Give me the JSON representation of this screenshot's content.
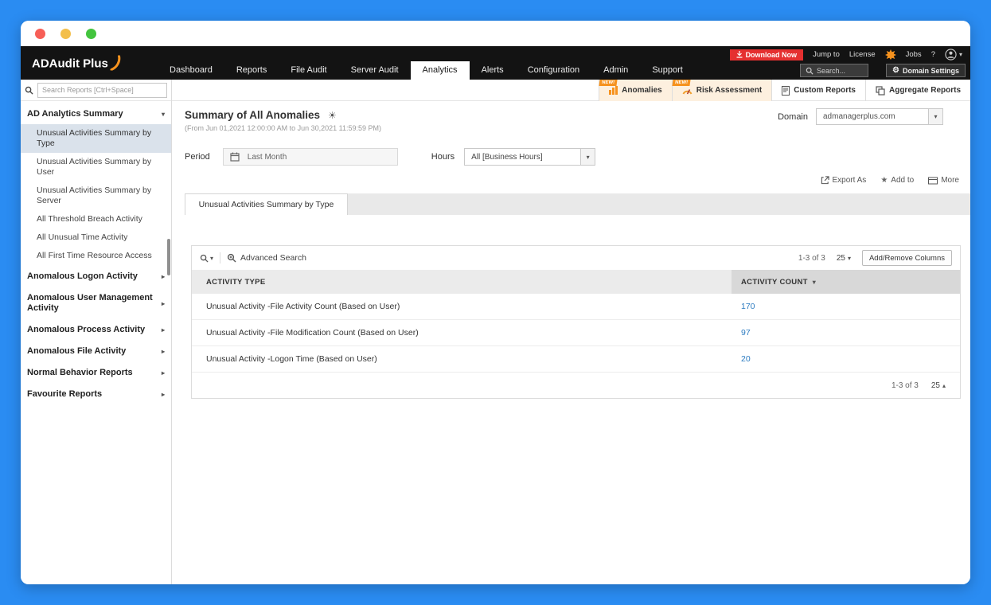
{
  "icons": {
    "chevron_down": "▾",
    "chevron_right": "▸",
    "chevron_up": "▴",
    "sun": "☀",
    "gear": "⚙",
    "star": "★"
  },
  "colors": {
    "frame_blue": "#2a8cf2",
    "accent_orange": "#f6921e",
    "download_red": "#e53030",
    "link_blue": "#2d7cc1"
  },
  "topbar": {
    "logo": "ADAudit Plus",
    "utility": {
      "download_now": "Download Now",
      "jump_to": "Jump to",
      "license": "License",
      "jobs": "Jobs",
      "help": "?"
    },
    "nav": [
      {
        "label": "Dashboard"
      },
      {
        "label": "Reports"
      },
      {
        "label": "File Audit"
      },
      {
        "label": "Server Audit"
      },
      {
        "label": "Analytics"
      },
      {
        "label": "Alerts"
      },
      {
        "label": "Configuration"
      },
      {
        "label": "Admin"
      },
      {
        "label": "Support"
      }
    ],
    "search_placeholder": "Search...",
    "domain_settings": "Domain Settings"
  },
  "ribbon": {
    "badge": "NEW!",
    "tabs": [
      {
        "label": "Anomalies"
      },
      {
        "label": "Risk Assessment"
      },
      {
        "label": "Custom Reports"
      },
      {
        "label": "Aggregate Reports"
      }
    ]
  },
  "sidebar": {
    "search_placeholder": "Search Reports [Ctrl+Space]",
    "section": {
      "label": "AD Analytics Summary"
    },
    "items": [
      {
        "label": "Unusual Activities Summary by Type"
      },
      {
        "label": "Unusual Activities Summary by User"
      },
      {
        "label": "Unusual Activities Summary by Server"
      },
      {
        "label": "All Threshold Breach Activity"
      },
      {
        "label": "All Unusual Time Activity"
      },
      {
        "label": "All First Time Resource Access"
      }
    ],
    "groups": [
      {
        "label": "Anomalous Logon Activity"
      },
      {
        "label": "Anomalous User Management Activity"
      },
      {
        "label": "Anomalous Process Activity"
      },
      {
        "label": "Anomalous File Activity"
      },
      {
        "label": "Normal Behavior Reports"
      },
      {
        "label": "Favourite Reports"
      }
    ]
  },
  "main": {
    "title": "Summary of All Anomalies",
    "subtitle": "(From Jun 01,2021 12:00:00 AM to Jun 30,2021 11:59:59 PM)",
    "domain": {
      "label": "Domain",
      "value": "admanagerplus.com"
    },
    "filters": {
      "period_label": "Period",
      "period_value": "Last Month",
      "hours_label": "Hours",
      "hours_value": "All [Business Hours]"
    },
    "actions": {
      "export_as": "Export As",
      "add_to": "Add to",
      "more": "More"
    },
    "view_tab": "Unusual Activities Summary by Type",
    "table": {
      "advanced_search": "Advanced Search",
      "range": "1-3 of 3",
      "page_size": "25",
      "add_remove_columns": "Add/Remove Columns",
      "columns": [
        {
          "label": "ACTIVITY TYPE"
        },
        {
          "label": "ACTIVITY COUNT"
        }
      ],
      "rows": [
        {
          "activity_type": "Unusual Activity -File Activity Count (Based on User)",
          "activity_count": "170"
        },
        {
          "activity_type": "Unusual Activity -File Modification Count (Based on User)",
          "activity_count": "97"
        },
        {
          "activity_type": "Unusual Activity -Logon Time (Based on User)",
          "activity_count": "20"
        }
      ],
      "footer_range": "1-3 of 3",
      "footer_page_size": "25"
    }
  }
}
